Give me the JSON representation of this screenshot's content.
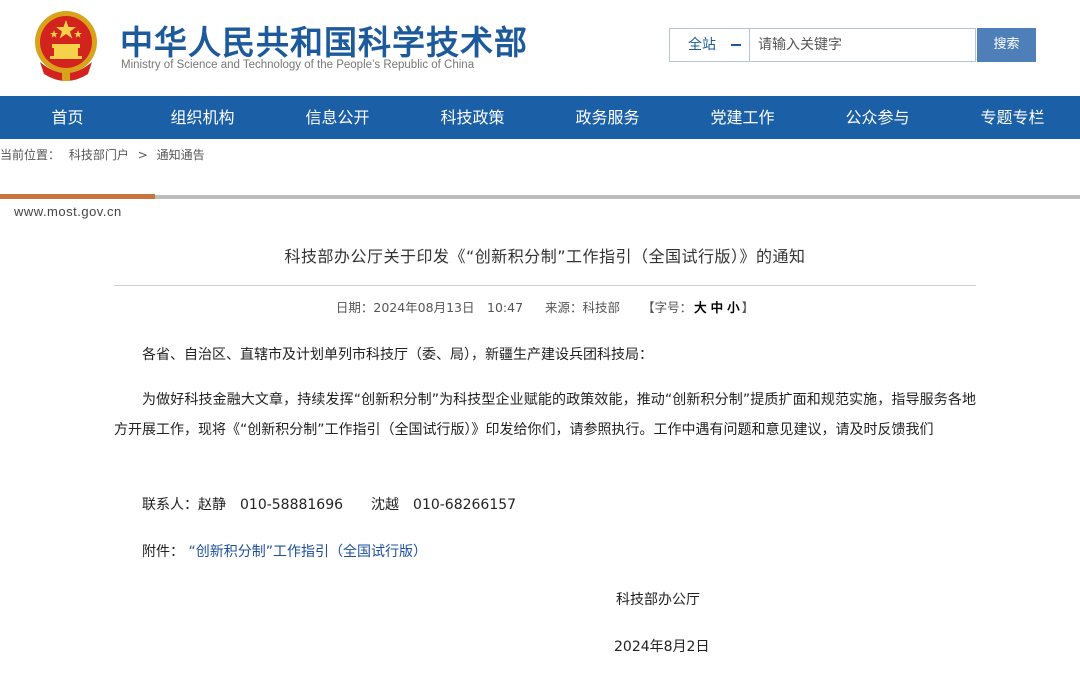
{
  "header": {
    "title": "中华人民共和国科学技术部",
    "subtitle": "Ministry of Science and Technology of the People’s Republic of China",
    "emblem_icon": "national-emblem-icon"
  },
  "search": {
    "scope_value": "全站",
    "placeholder": "请输入关键字",
    "button_label": "搜索"
  },
  "colors": {
    "brand_blue": "#1b5fa6",
    "title_blue": "#1d5a9c",
    "accent_orange": "#c8743e",
    "search_button": "#4f7fb8"
  },
  "nav": {
    "items": [
      "首页",
      "组织机构",
      "信息公开",
      "科技政策",
      "政务服务",
      "党建工作",
      "公众参与",
      "专题专栏"
    ]
  },
  "breadcrumb": {
    "prefix": "当前位置：",
    "items": [
      "科技部门户",
      ">",
      "通知通告"
    ]
  },
  "domain": "www.most.gov.cn",
  "article": {
    "title": "科技部办公厅关于印发《“创新积分制”工作指引（全国试行版）》的通知",
    "meta": {
      "date_label": "日期：",
      "date_value": "2024年08月13日　10:47",
      "source_label": "来源：",
      "source_value": "科技部",
      "font_label_open": "【字号：",
      "font_sizes": [
        "大",
        "中",
        "小"
      ],
      "font_label_close": "】"
    },
    "greeting": "各省、自治区、直辖市及计划单列市科技厅（委、局），新疆生产建设兵团科技局：",
    "body": "为做好科技金融大文章，持续发挥“创新积分制”为科技型企业赋能的政策效能，推动“创新积分制”提质扩面和规范实施，指导服务各地方开展工作，现将《“创新积分制”工作指引（全国试行版）》印发给你们，请参照执行。工作中遇有问题和意见建议，请及时反馈我们",
    "contact": "联系人：赵静　010-58881696　　沈越　010-68266157",
    "attachment_label": "附件：",
    "attachment_link": "“创新积分制”工作指引（全国试行版）",
    "signature": "科技部办公厅",
    "sign_date": "2024年8月2日"
  }
}
